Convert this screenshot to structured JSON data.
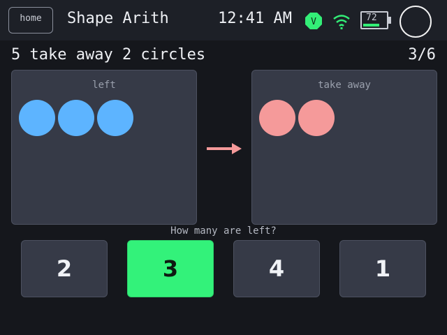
{
  "header": {
    "home_label": "home",
    "app_title": "Shape Arith",
    "time": "12:41 AM",
    "v_badge": "V",
    "battery_percent": "72",
    "battery_level": 0.72
  },
  "question": {
    "text": "5 take away 2 circles",
    "progress": "3/6"
  },
  "left_panel": {
    "label": "left",
    "circle_count": 3,
    "circle_color": "#5db4ff"
  },
  "right_panel": {
    "label": "take away",
    "circle_count": 2,
    "circle_color": "#f59a9a"
  },
  "prompt": "How many are left?",
  "answers": [
    {
      "label": "2",
      "selected": false
    },
    {
      "label": "3",
      "selected": true
    },
    {
      "label": "4",
      "selected": false
    },
    {
      "label": "1",
      "selected": false
    }
  ],
  "colors": {
    "accent": "#33f27a",
    "arrow": "#f59a9a",
    "panel": "#363a47",
    "background": "#15171c"
  }
}
